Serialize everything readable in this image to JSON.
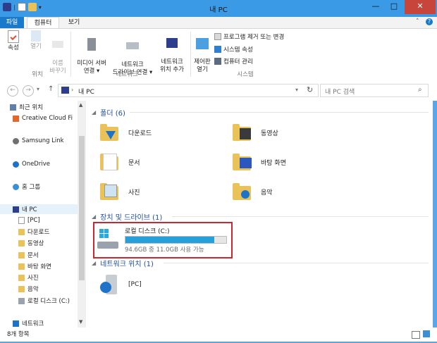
{
  "window": {
    "title": "내 PC",
    "minimize": "—",
    "maximize": "□",
    "close": "✕"
  },
  "ribbon_tabs": [
    {
      "label": "파일"
    },
    {
      "label": "컴퓨터"
    },
    {
      "label": "보기"
    }
  ],
  "ribbon": {
    "location_group": "위치",
    "network_group": "네트워크",
    "system_group": "시스템",
    "properties": "속성",
    "open": "열기",
    "rename": "이름\n바꾸기",
    "media_server": "미디어 서버\n연결 ▾",
    "map_drive": "네트워크\n드라이브 연결 ▾",
    "add_location": "네트워크\n위치 추가",
    "control_panel": "제어판\n열기",
    "uninstall": "프로그램 제거 또는 변경",
    "system_props": "시스템 속성",
    "manage": "컴퓨터 관리"
  },
  "address": {
    "path": "내 PC",
    "search_placeholder": "내 PC 검색"
  },
  "nav": {
    "items": [
      {
        "label": "최근 위치"
      },
      {
        "label": "Creative Cloud Fi"
      },
      {
        "label": "Samsung Link"
      },
      {
        "label": "OneDrive"
      },
      {
        "label": "홈 그룹"
      },
      {
        "label": "내 PC"
      },
      {
        "label": "[PC]"
      },
      {
        "label": "다운로드"
      },
      {
        "label": "동영상"
      },
      {
        "label": "문서"
      },
      {
        "label": "바탕 화면"
      },
      {
        "label": "사진"
      },
      {
        "label": "음악"
      },
      {
        "label": "로컬 디스크 (C:)"
      },
      {
        "label": "네트워크"
      }
    ]
  },
  "sections": {
    "folders": "폴더 (6)",
    "devices": "장치 및 드라이브 (1)",
    "network": "네트워크 위치 (1)"
  },
  "folders": [
    {
      "label": "다운로드"
    },
    {
      "label": "동영상"
    },
    {
      "label": "문서"
    },
    {
      "label": "바탕 화면"
    },
    {
      "label": "사진"
    },
    {
      "label": "음악"
    }
  ],
  "drive": {
    "label": "로컬 디스크 (C:)",
    "space": "94.6GB 중 11.0GB 사용 가능",
    "used_fraction": 0.884
  },
  "network_item": {
    "label": "[PC]"
  },
  "status": {
    "count": "8개 항목"
  }
}
